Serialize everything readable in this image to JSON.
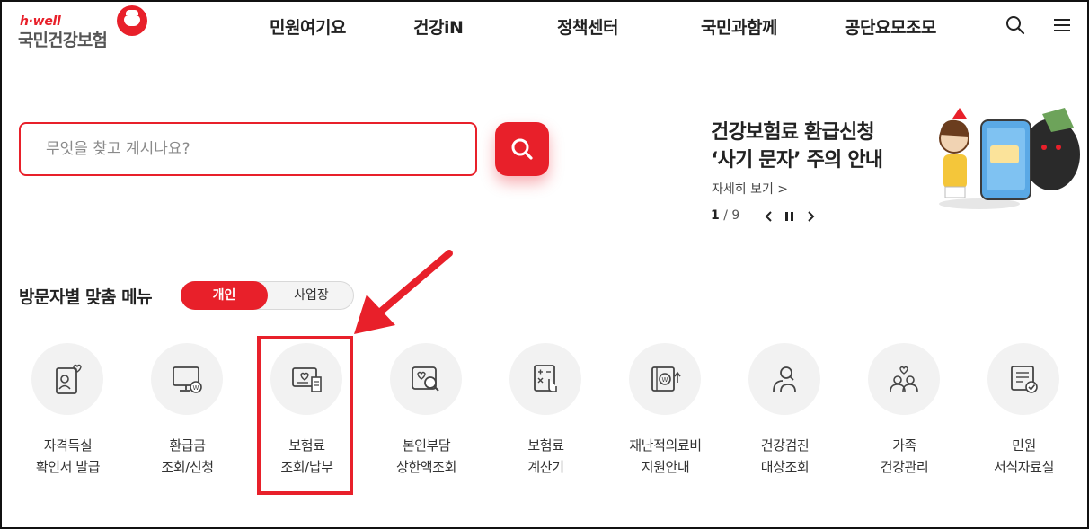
{
  "logo": {
    "small": "h·well",
    "main": "국민건강보험"
  },
  "gnb": [
    {
      "label": "민원여기요"
    },
    {
      "label": "건강iN"
    },
    {
      "label": "정책센터"
    },
    {
      "label": "국민과함께"
    },
    {
      "label": "공단요모조모"
    }
  ],
  "header_icons": {
    "search": "search-icon",
    "menu": "hamburger-icon"
  },
  "search": {
    "placeholder": "무엇을 찾고 계시나요?",
    "value": ""
  },
  "banner": {
    "title_line1": "건강보험료 환급신청",
    "title_line2": "‘사기 문자’ 주의 안내",
    "more": "자세히 보기 >",
    "page_current": "1",
    "page_sep": " / ",
    "page_total": "9"
  },
  "section": {
    "title": "방문자별 맞춤 메뉴",
    "toggle": [
      "개인",
      "사업장"
    ],
    "selected": "개인"
  },
  "menu": [
    {
      "line1": "자격득실",
      "line2": "확인서 발급",
      "icon": "certificate-icon"
    },
    {
      "line1": "환급금",
      "line2": "조회/신청",
      "icon": "refund-monitor-icon"
    },
    {
      "line1": "보험료",
      "line2": "조회/납부",
      "icon": "premium-bill-icon"
    },
    {
      "line1": "본인부담",
      "line2": "상한액조회",
      "icon": "copay-search-icon"
    },
    {
      "line1": "보험료",
      "line2": "계산기",
      "icon": "calculator-icon"
    },
    {
      "line1": "재난적의료비",
      "line2": "지원안내",
      "icon": "medical-aid-icon"
    },
    {
      "line1": "건강검진",
      "line2": "대상조회",
      "icon": "checkup-icon"
    },
    {
      "line1": "가족",
      "line2": "건강관리",
      "icon": "family-icon"
    },
    {
      "line1": "민원",
      "line2": "서식자료실",
      "icon": "forms-icon"
    }
  ],
  "colors": {
    "brand": "#e8202a",
    "text": "#222222",
    "circle": "#f2f2f2"
  }
}
